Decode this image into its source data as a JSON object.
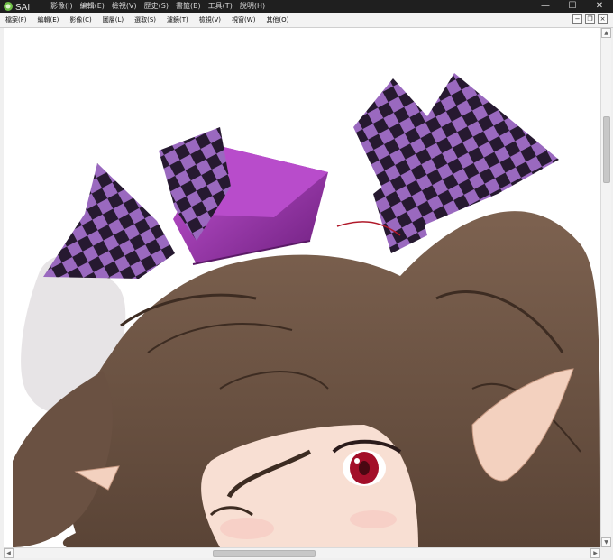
{
  "app": {
    "logo_text": "SAI",
    "title_menu": [
      "影像(I)",
      "編輯(E)",
      "檢視(V)",
      "歷史(S)",
      "書籤(B)",
      "工具(T)",
      "說明(H)"
    ]
  },
  "window_controls": {
    "minimize_icon": "—",
    "maximize_icon": "☐",
    "close_icon": "✕"
  },
  "menubar": {
    "items": [
      "檔案(F)",
      "編輯(E)",
      "影像(C)",
      "圖層(L)",
      "選取(S)",
      "濾鏡(T)",
      "檢視(V)",
      "視窗(W)",
      "其他(O)"
    ]
  },
  "mdi_controls": {
    "minimize_icon": "−",
    "restore_icon": "❐",
    "close_icon": "×"
  },
  "scrollbars": {
    "up_icon": "▲",
    "down_icon": "▼",
    "left_icon": "◀",
    "right_icon": "▶"
  },
  "colors": {
    "hair": "#6e5646",
    "hair_dark": "#3d2c22",
    "ribbon_light": "#9b6bc1",
    "ribbon_dark": "#2b1b34",
    "hat": "#a637b8",
    "skin": "#f8dfd3",
    "eye": "#a30f2a"
  }
}
